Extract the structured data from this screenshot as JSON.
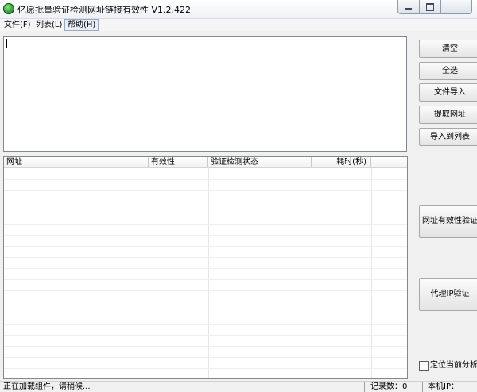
{
  "window": {
    "title": "亿愿批量验证检测网址链接有效性 V1.2.422"
  },
  "menu": {
    "items": [
      "文件(F)",
      "列表(L)",
      "帮助(H)"
    ]
  },
  "table": {
    "columns": [
      "网址",
      "有效性",
      "验证检测状态",
      "耗时(秒)"
    ],
    "rows": []
  },
  "buttons": {
    "clear": "清空",
    "select_all": "全选",
    "import_file": "文件导入",
    "extract_urls": "提取网址",
    "import_to_list": "导入到列表",
    "verify_urls": "网址有效性验证",
    "proxy_verify": "代理IP验证"
  },
  "options": {
    "locate_current": "定位当前分析项",
    "locate_current_checked": false
  },
  "status": {
    "loading": "正在加载组件，请稍候...",
    "record_count": "记录数：0",
    "local_ip": "本机IP："
  }
}
